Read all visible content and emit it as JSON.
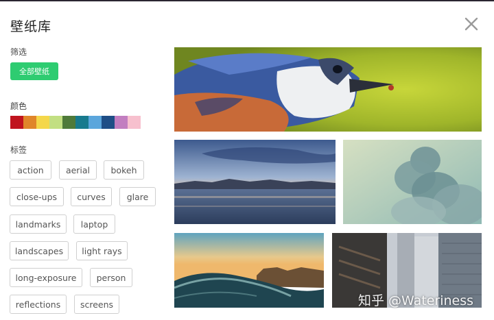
{
  "header": {
    "title": "壁纸库",
    "close_icon": "close-icon"
  },
  "filter": {
    "label": "筛选",
    "all_button": "全部壁纸",
    "accent": "#2ecc71"
  },
  "colors": {
    "label": "颜色",
    "swatches": [
      "#c0141e",
      "#e0862a",
      "#f4d74a",
      "#c2df82",
      "#4f7a3a",
      "#187a8e",
      "#5ba6dc",
      "#1f4e86",
      "#c27ec0",
      "#f7c0ce"
    ]
  },
  "tags": {
    "label": "标签",
    "items": [
      "action",
      "aerial",
      "bokeh",
      "close-ups",
      "curves",
      "glare",
      "landmarks",
      "laptop",
      "landscapes",
      "light rays",
      "long-exposure",
      "person",
      "reflections",
      "screens"
    ]
  },
  "gallery": {
    "images": [
      "bird-closeup",
      "lake-mountains-sunset",
      "smoke-cloud",
      "ocean-wave-coast",
      "city-buildings"
    ]
  },
  "watermark": "知乎 @Wateriness"
}
